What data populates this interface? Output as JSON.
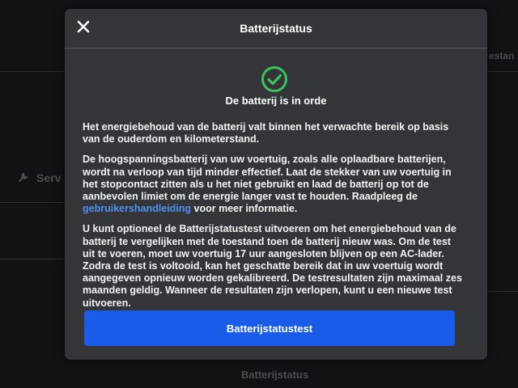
{
  "background": {
    "service_label": "Serv",
    "edge_text": "estan",
    "bottom_label": "Batterijstatus"
  },
  "modal": {
    "title": "Batterijstatus",
    "close_icon": "close-icon",
    "status": {
      "icon": "check-circle-icon",
      "text": "De batterij is in orde",
      "color": "#3cc25a"
    },
    "paragraphs": {
      "p1": "Het energiebehoud van de batterij valt binnen het verwachte bereik op basis van de ouderdom en kilometerstand.",
      "p2_before_link": "De hoogspanningsbatterij van uw voertuig, zoals alle oplaadbare batterijen, wordt na verloop van tijd minder effectief. Laat de stekker van uw voertuig in het stopcontact zitten als u het niet gebruikt en laad de batterij op tot de aanbevolen limiet om de energie langer vast te houden. Raadpleeg de",
      "p2_link": "gebruikershandleiding",
      "p2_after_link": " voor meer informatie.",
      "p3": "U kunt optioneel de Batterijstatustest uitvoeren om het energiebehoud van de batterij te vergelijken met de toestand toen de batterij nieuw was. Om de test uit te voeren, moet uw voertuig 17 uur aangesloten blijven op een AC-lader. Zodra de test is voltooid, kan het geschatte bereik dat in uw voertuig wordt aangegeven opnieuw worden gekalibreerd. De testresultaten zijn maximaal zes maanden geldig. Wanneer de resultaten zijn verlopen, kunt u een nieuwe test uitvoeren."
    },
    "button_label": "Batterijstatustest",
    "colors": {
      "accent_button": "#1a5ce9",
      "link": "#4f8ff0",
      "panel": "#333538"
    }
  }
}
